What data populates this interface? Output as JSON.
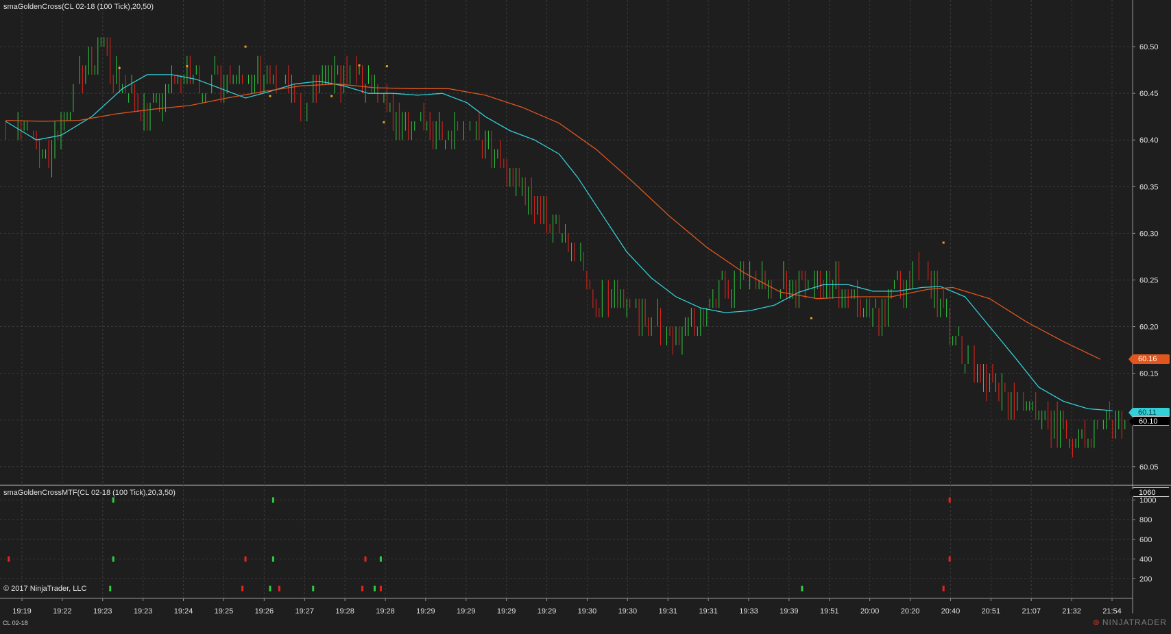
{
  "header": {
    "main_title": "smaGoldenCross(CL 02-18 (100 Tick),20,50)",
    "sub_title": "smaGoldenCrossMTF(CL 02-18 (100 Tick),20,3,50)",
    "copyright": "© 2017 NinjaTrader, LLC",
    "instrument": "CL 02-18",
    "logo": "NINJATRADER"
  },
  "colors": {
    "background": "#1e1e1e",
    "grid": "#3a3a3a",
    "up_bar": "#2ecc40",
    "down_bar": "#e8241c",
    "fast_sma": "#34d0d8",
    "slow_sma": "#e0561e",
    "signal_dot": "#f0a020"
  },
  "badges": {
    "slow_value": "60.16",
    "fast_value": "60.11",
    "last_price": "60.10",
    "indicator_value": "1060"
  },
  "chart_data": [
    {
      "type": "line",
      "subtype": "tick-bars-with-moving-averages",
      "title": "smaGoldenCross(CL 02-18 (100 Tick),20,50)",
      "ylim": [
        60.03,
        60.55
      ],
      "yticks": [
        60.05,
        60.1,
        60.15,
        60.2,
        60.25,
        60.3,
        60.35,
        60.4,
        60.45,
        60.5
      ],
      "ytick_labels": [
        "60.05",
        "60.10",
        "60.15",
        "60.20",
        "60.25",
        "60.30",
        "60.35",
        "60.40",
        "60.45",
        "60.50"
      ],
      "x_ticks": [
        "19:19",
        "19:22",
        "19:23",
        "19:23",
        "19:24",
        "19:25",
        "19:26",
        "19:27",
        "19:28",
        "19:28",
        "19:29",
        "19:29",
        "19:29",
        "19:29",
        "19:30",
        "19:30",
        "19:31",
        "19:31",
        "19:33",
        "19:39",
        "19:51",
        "20:00",
        "20:20",
        "20:40",
        "20:51",
        "21:07",
        "21:32",
        "21:54"
      ],
      "grid": true,
      "bar_anchors": [
        {
          "i": 0,
          "p": 60.42
        },
        {
          "i": 8,
          "p": 60.4
        },
        {
          "i": 14,
          "p": 60.38
        },
        {
          "i": 22,
          "p": 60.45
        },
        {
          "i": 28,
          "p": 60.49
        },
        {
          "i": 32,
          "p": 60.5
        },
        {
          "i": 36,
          "p": 60.47
        },
        {
          "i": 44,
          "p": 60.43
        },
        {
          "i": 50,
          "p": 60.44
        },
        {
          "i": 56,
          "p": 60.47
        },
        {
          "i": 66,
          "p": 60.46
        },
        {
          "i": 72,
          "p": 60.47
        },
        {
          "i": 82,
          "p": 60.47
        },
        {
          "i": 90,
          "p": 60.46
        },
        {
          "i": 96,
          "p": 60.43
        },
        {
          "i": 104,
          "p": 60.46
        },
        {
          "i": 112,
          "p": 60.47
        },
        {
          "i": 120,
          "p": 60.45
        },
        {
          "i": 128,
          "p": 60.42
        },
        {
          "i": 138,
          "p": 60.41
        },
        {
          "i": 148,
          "p": 60.42
        },
        {
          "i": 156,
          "p": 60.39
        },
        {
          "i": 162,
          "p": 60.37
        },
        {
          "i": 170,
          "p": 60.34
        },
        {
          "i": 178,
          "p": 60.31
        },
        {
          "i": 186,
          "p": 60.27
        },
        {
          "i": 192,
          "p": 60.22
        },
        {
          "i": 198,
          "p": 60.24
        },
        {
          "i": 206,
          "p": 60.21
        },
        {
          "i": 214,
          "p": 60.2
        },
        {
          "i": 222,
          "p": 60.19
        },
        {
          "i": 230,
          "p": 60.23
        },
        {
          "i": 240,
          "p": 60.25
        },
        {
          "i": 250,
          "p": 60.24
        },
        {
          "i": 262,
          "p": 60.25
        },
        {
          "i": 272,
          "p": 60.24
        },
        {
          "i": 282,
          "p": 60.21
        },
        {
          "i": 290,
          "p": 60.24
        },
        {
          "i": 298,
          "p": 60.26
        },
        {
          "i": 304,
          "p": 60.22
        },
        {
          "i": 310,
          "p": 60.18
        },
        {
          "i": 318,
          "p": 60.14
        },
        {
          "i": 326,
          "p": 60.12
        },
        {
          "i": 334,
          "p": 60.11
        },
        {
          "i": 342,
          "p": 60.09
        },
        {
          "i": 350,
          "p": 60.08
        },
        {
          "i": 358,
          "p": 60.1
        },
        {
          "i": 364,
          "p": 60.1
        }
      ],
      "series": [
        {
          "role": "fast_sma",
          "color": "#34d0d8",
          "points": [
            {
              "i": 0,
              "y": 60.42
            },
            {
              "i": 10,
              "y": 60.4
            },
            {
              "i": 18,
              "y": 60.405
            },
            {
              "i": 28,
              "y": 60.425
            },
            {
              "i": 38,
              "y": 60.455
            },
            {
              "i": 46,
              "y": 60.47
            },
            {
              "i": 54,
              "y": 60.47
            },
            {
              "i": 62,
              "y": 60.465
            },
            {
              "i": 70,
              "y": 60.455
            },
            {
              "i": 78,
              "y": 60.445
            },
            {
              "i": 86,
              "y": 60.452
            },
            {
              "i": 94,
              "y": 60.46
            },
            {
              "i": 102,
              "y": 60.463
            },
            {
              "i": 110,
              "y": 60.458
            },
            {
              "i": 118,
              "y": 60.45
            },
            {
              "i": 126,
              "y": 60.45
            },
            {
              "i": 134,
              "y": 60.448
            },
            {
              "i": 142,
              "y": 60.45
            },
            {
              "i": 150,
              "y": 60.44
            },
            {
              "i": 156,
              "y": 60.425
            },
            {
              "i": 164,
              "y": 60.41
            },
            {
              "i": 172,
              "y": 60.4
            },
            {
              "i": 180,
              "y": 60.385
            },
            {
              "i": 186,
              "y": 60.36
            },
            {
              "i": 194,
              "y": 60.32
            },
            {
              "i": 202,
              "y": 60.28
            },
            {
              "i": 210,
              "y": 60.252
            },
            {
              "i": 218,
              "y": 60.232
            },
            {
              "i": 226,
              "y": 60.22
            },
            {
              "i": 234,
              "y": 60.215
            },
            {
              "i": 242,
              "y": 60.217
            },
            {
              "i": 250,
              "y": 60.223
            },
            {
              "i": 258,
              "y": 60.237
            },
            {
              "i": 266,
              "y": 60.245
            },
            {
              "i": 274,
              "y": 60.245
            },
            {
              "i": 282,
              "y": 60.238
            },
            {
              "i": 290,
              "y": 60.238
            },
            {
              "i": 298,
              "y": 60.242
            },
            {
              "i": 304,
              "y": 60.243
            },
            {
              "i": 312,
              "y": 60.232
            },
            {
              "i": 320,
              "y": 60.2
            },
            {
              "i": 328,
              "y": 60.168
            },
            {
              "i": 336,
              "y": 60.135
            },
            {
              "i": 344,
              "y": 60.12
            },
            {
              "i": 352,
              "y": 60.112
            },
            {
              "i": 360,
              "y": 60.11
            }
          ]
        },
        {
          "role": "slow_sma",
          "color": "#e0561e",
          "points": [
            {
              "i": 0,
              "y": 60.421
            },
            {
              "i": 12,
              "y": 60.42
            },
            {
              "i": 24,
              "y": 60.421
            },
            {
              "i": 36,
              "y": 60.428
            },
            {
              "i": 48,
              "y": 60.433
            },
            {
              "i": 60,
              "y": 60.437
            },
            {
              "i": 72,
              "y": 60.445
            },
            {
              "i": 84,
              "y": 60.452
            },
            {
              "i": 96,
              "y": 60.458
            },
            {
              "i": 108,
              "y": 60.46
            },
            {
              "i": 120,
              "y": 60.456
            },
            {
              "i": 132,
              "y": 60.455
            },
            {
              "i": 144,
              "y": 60.455
            },
            {
              "i": 156,
              "y": 60.448
            },
            {
              "i": 168,
              "y": 60.435
            },
            {
              "i": 180,
              "y": 60.418
            },
            {
              "i": 192,
              "y": 60.39
            },
            {
              "i": 204,
              "y": 60.355
            },
            {
              "i": 216,
              "y": 60.318
            },
            {
              "i": 228,
              "y": 60.285
            },
            {
              "i": 240,
              "y": 60.258
            },
            {
              "i": 252,
              "y": 60.237
            },
            {
              "i": 264,
              "y": 60.23
            },
            {
              "i": 276,
              "y": 60.232
            },
            {
              "i": 288,
              "y": 60.232
            },
            {
              "i": 300,
              "y": 60.24
            },
            {
              "i": 308,
              "y": 60.242
            },
            {
              "i": 320,
              "y": 60.23
            },
            {
              "i": 332,
              "y": 60.205
            },
            {
              "i": 344,
              "y": 60.184
            },
            {
              "i": 356,
              "y": 60.165
            }
          ]
        }
      ],
      "signals": [
        {
          "i": 37,
          "y": 60.477
        },
        {
          "i": 59,
          "y": 60.479
        },
        {
          "i": 78,
          "y": 60.5
        },
        {
          "i": 86,
          "y": 60.447
        },
        {
          "i": 106,
          "y": 60.447
        },
        {
          "i": 115,
          "y": 60.48
        },
        {
          "i": 123,
          "y": 60.419
        },
        {
          "i": 124,
          "y": 60.479
        },
        {
          "i": 262,
          "y": 60.209
        },
        {
          "i": 305,
          "y": 60.29
        }
      ]
    },
    {
      "type": "bar",
      "subtype": "signal-histogram",
      "title": "smaGoldenCrossMTF(CL 02-18 (100 Tick),20,3,50)",
      "ylim": [
        0,
        1150
      ],
      "yticks": [
        200,
        400,
        600,
        800,
        1000
      ],
      "ytick_labels": [
        "200",
        "400",
        "600",
        "800",
        "1000"
      ],
      "grid": true,
      "markers": [
        {
          "i": 1,
          "y": 400,
          "color": "red"
        },
        {
          "i": 34,
          "y": 100,
          "color": "green"
        },
        {
          "i": 35,
          "y": 400,
          "color": "green"
        },
        {
          "i": 35,
          "y": 1000,
          "color": "green"
        },
        {
          "i": 77,
          "y": 100,
          "color": "red"
        },
        {
          "i": 78,
          "y": 400,
          "color": "red"
        },
        {
          "i": 86,
          "y": 100,
          "color": "green"
        },
        {
          "i": 87,
          "y": 400,
          "color": "green"
        },
        {
          "i": 87,
          "y": 1000,
          "color": "green"
        },
        {
          "i": 89,
          "y": 100,
          "color": "red"
        },
        {
          "i": 100,
          "y": 100,
          "color": "green"
        },
        {
          "i": 116,
          "y": 100,
          "color": "red"
        },
        {
          "i": 117,
          "y": 400,
          "color": "red"
        },
        {
          "i": 120,
          "y": 100,
          "color": "green"
        },
        {
          "i": 122,
          "y": 100,
          "color": "red"
        },
        {
          "i": 122,
          "y": 400,
          "color": "green"
        },
        {
          "i": 259,
          "y": 100,
          "color": "green"
        },
        {
          "i": 305,
          "y": 100,
          "color": "red"
        },
        {
          "i": 307,
          "y": 400,
          "color": "red"
        },
        {
          "i": 307,
          "y": 1000,
          "color": "red"
        }
      ]
    }
  ]
}
